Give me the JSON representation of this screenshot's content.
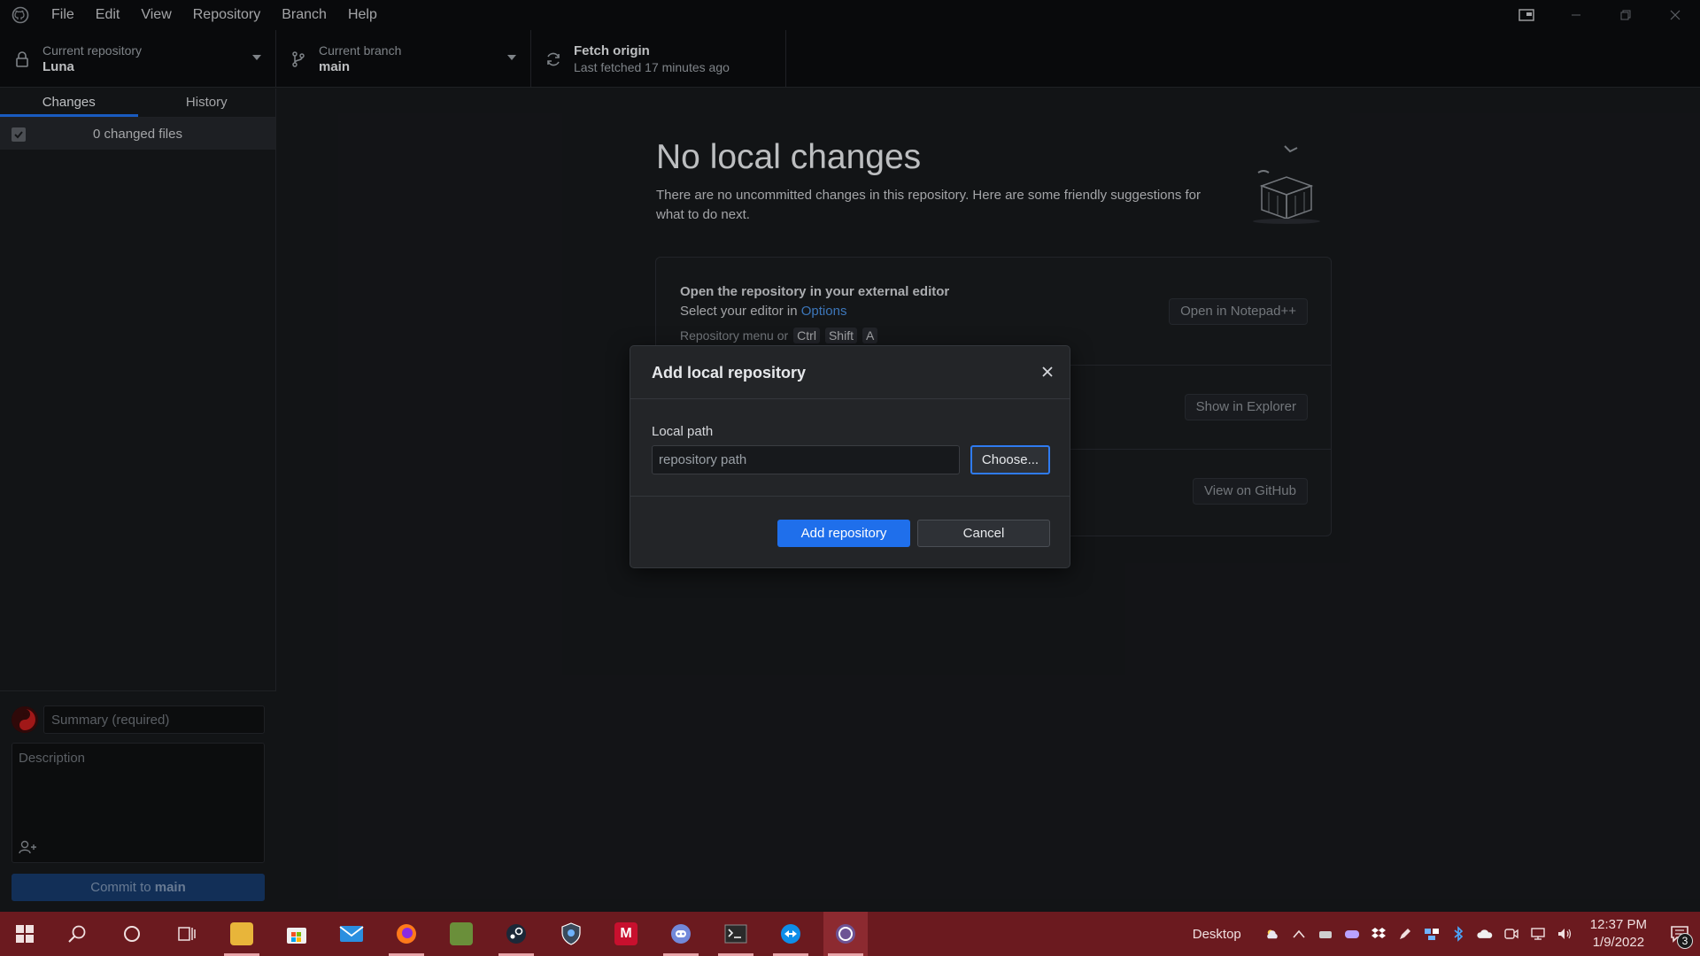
{
  "menu": [
    "File",
    "Edit",
    "View",
    "Repository",
    "Branch",
    "Help"
  ],
  "toolbar": {
    "repo_label": "Current repository",
    "repo_name": "Luna",
    "branch_label": "Current branch",
    "branch_name": "main",
    "fetch_title": "Fetch origin",
    "fetch_sub": "Last fetched 17 minutes ago"
  },
  "sidebar": {
    "tabs": [
      "Changes",
      "History"
    ],
    "active_tab": "Changes",
    "changed_files": "0 changed files",
    "summary_placeholder": "Summary (required)",
    "description_placeholder": "Description",
    "commit_prefix": "Commit to",
    "commit_branch": "main"
  },
  "main": {
    "heading": "No local changes",
    "subheading": "There are no uncommitted changes in this repository. Here are some friendly suggestions for what to do next.",
    "suggestions": {
      "editor_title": "Open the repository in your external editor",
      "editor_desc": "Select your editor in",
      "editor_link": "Options",
      "editor_hint": "Repository menu or",
      "editor_keys": [
        "Ctrl",
        "Shift",
        "A"
      ],
      "editor_button": "Open in Notepad++",
      "explorer_button": "Show in Explorer",
      "github_button": "View on GitHub"
    }
  },
  "dialog": {
    "title": "Add local repository",
    "field_label": "Local path",
    "path_placeholder": "repository path",
    "choose_label": "Choose...",
    "add_label": "Add repository",
    "cancel_label": "Cancel"
  },
  "taskbar": {
    "desktop_label": "Desktop",
    "time": "12:37 PM",
    "date": "1/9/2022",
    "notification_count": "3"
  },
  "colors": {
    "accent": "#1f6feb",
    "taskbar": "#6b1a1f",
    "titlebar": "#0c0d0f"
  }
}
